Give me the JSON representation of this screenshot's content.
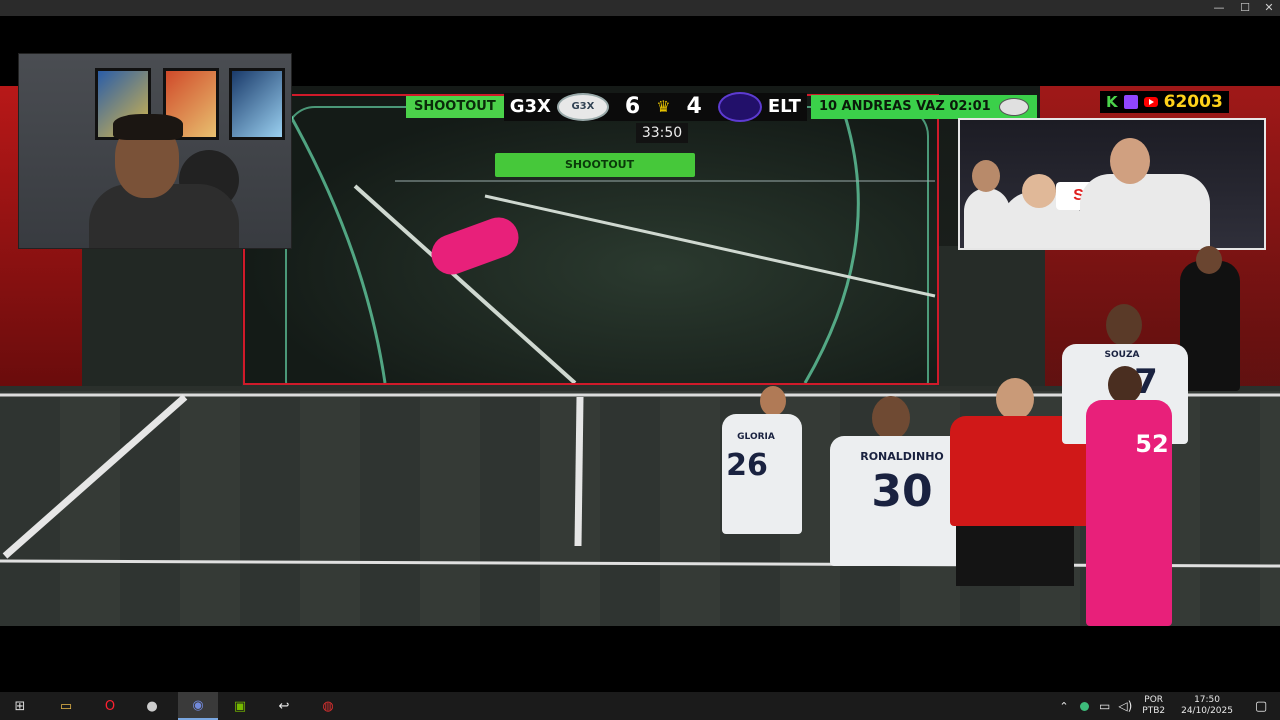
{
  "window": {
    "minimize_glyph": "—",
    "maximize_glyph": "☐",
    "close_glyph": "✕"
  },
  "scoreboard": {
    "mode_label": "SHOOTOUT",
    "home_team": "G3X",
    "home_score": "6",
    "away_score": "4",
    "away_team": "ELT",
    "player_info": "10 ANDREAS VAZ 02:01",
    "clock": "33:50",
    "home_logo_text": "G3X"
  },
  "stream_overlay": {
    "viewer_count": "62003",
    "platform_icons": [
      "kick-icon",
      "twitch-icon",
      "youtube-icon"
    ],
    "k_label": "K"
  },
  "big_screen": {
    "banner_text": "SHOOTOUT"
  },
  "caster_cam": {
    "sponsor_text": "Se"
  },
  "players": {
    "p1_name": "GLORIA",
    "p1_number": "26",
    "p2_name": "RONALDINHO",
    "p2_number": "30",
    "p3_name": "SOUZA",
    "p3_number": "7",
    "p4_number": "52"
  },
  "taskbar": {
    "apps": [
      {
        "name": "windows-start-icon",
        "glyph": "⊞"
      },
      {
        "name": "file-explorer-icon",
        "glyph": "▭"
      },
      {
        "name": "opera-browser-icon",
        "glyph": "O"
      },
      {
        "name": "app-icon",
        "glyph": "●"
      },
      {
        "name": "discord-icon",
        "glyph": "◉"
      },
      {
        "name": "nvidia-icon",
        "glyph": "▣"
      },
      {
        "name": "back-arrow-app-icon",
        "glyph": "↩"
      },
      {
        "name": "record-app-icon",
        "glyph": "◍"
      }
    ],
    "tray": {
      "chevron": "⌃",
      "language_line1": "POR",
      "language_line2": "PTB2",
      "time": "17:50",
      "date": "24/10/2025",
      "notification_glyph": "▢"
    }
  },
  "colors": {
    "shootout_green": "#4bd24a",
    "viewer_yellow": "#ffd21a",
    "wall_red": "#b81818",
    "goalkeeper_pink": "#e8207a",
    "referee_red": "#d01818"
  }
}
